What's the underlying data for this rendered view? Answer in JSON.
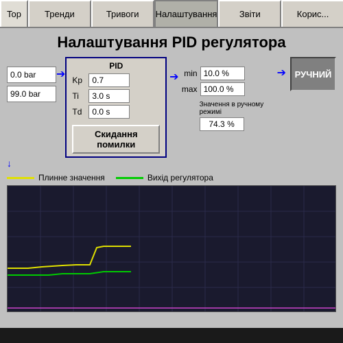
{
  "nav": {
    "items": [
      {
        "label": "Top",
        "id": "top"
      },
      {
        "label": "Тренди",
        "id": "trends"
      },
      {
        "label": "Тривоги",
        "id": "alarms"
      },
      {
        "label": "Налаштування",
        "id": "settings"
      },
      {
        "label": "Звіти",
        "id": "reports"
      },
      {
        "label": "Корис...",
        "id": "users"
      }
    ]
  },
  "page": {
    "title": "Налаштування PID регулятора"
  },
  "inputs": {
    "left1": "0.0 bar",
    "left2": "99.0 bar"
  },
  "pid": {
    "section_title": "PID",
    "kp_label": "Kp",
    "kp_value": "0.7",
    "ti_label": "Ti",
    "ti_value": "3.0 s",
    "td_label": "Td",
    "td_value": "0.0 s"
  },
  "reset_button": {
    "label": "Скидання помилки"
  },
  "minmax": {
    "min_label": "min",
    "min_value": "10.0 %",
    "max_label": "max",
    "max_value": "100.0 %"
  },
  "manual": {
    "button_label": "РУЧНИЙ",
    "note": "Значення в ручному режимі",
    "value": "74.3 %"
  },
  "legend": {
    "item1_label": "Плинне значення",
    "item1_color": "#e0e000",
    "item2_label": "Вихід регулятора",
    "item2_color": "#00cc00"
  },
  "chart": {
    "background": "#1a1a2e",
    "grid_color": "#2a2a4a"
  }
}
